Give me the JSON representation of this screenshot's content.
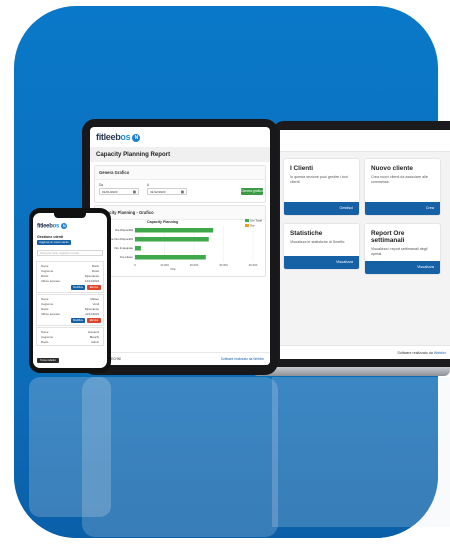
{
  "brand": {
    "name_a": "fitleeb",
    "name_b": "os",
    "badge": "N"
  },
  "laptop": {
    "cards": [
      {
        "title": "I Clienti",
        "text": "In questa sezione puoi gestire i tuoi clienti.",
        "button": "Gestisci"
      },
      {
        "title": "Nuovo cliente",
        "text": "Crea nuovi clienti da associare alle commesse.",
        "button": "Crea"
      },
      {
        "title": "Statistiche",
        "text": "Visualizza le statistiche di Smelfo.",
        "button": "Visualizza"
      },
      {
        "title": "Report Ore settimanali",
        "text": "Visualizza i report settimanali degli operai.",
        "button": "Visualizza"
      }
    ],
    "footer": {
      "text": "Software realizzato da",
      "brand": "Webfox"
    }
  },
  "tablet": {
    "page_title": "Capacity Planning Report",
    "filter": {
      "header": "Genera Grafico",
      "from_label": "Da",
      "to_label": "A",
      "from_value": "01/01/2020",
      "to_value": "31/12/2020",
      "button": "Genera grafico"
    },
    "chart_section_header": "Capacity Planning - Grafico",
    "footer_left": "© 2024 - TECHNI",
    "footer_right": "Software realizzato da Webfox"
  },
  "chart_data": {
    "type": "bar",
    "orientation": "horizontal",
    "title": "Capacity Planning",
    "categories": [
      "Ore Disponibili",
      "Ore Non Disponibili",
      "Ore Impegnate",
      "Ore Libere"
    ],
    "series": [
      {
        "name": "Ore Totali",
        "color": "#3ea84a",
        "values": [
          53000,
          50000,
          4000,
          48000
        ]
      },
      {
        "name": "Ore",
        "color": "#f0a020",
        "values": [
          0,
          0,
          0,
          0
        ]
      }
    ],
    "x_ticks": [
      "0",
      "10.000",
      "20.000",
      "30.000",
      "40.000"
    ],
    "xlim": [
      0,
      80000
    ],
    "xlabel": "Ore"
  },
  "phone": {
    "section_title": "Gestione utenti",
    "add_button": "Aggiungi un nuovo utente",
    "search_placeholder": "Cerca per nome, cognome o email...",
    "records": [
      {
        "rows": [
          [
            "Nome",
            "Mario"
          ],
          [
            "Cognome",
            "Rossi"
          ],
          [
            "Ruolo",
            "Dipendente"
          ],
          [
            "Ultimo accesso",
            "12/12/2023"
          ]
        ],
        "edit": "Modifica",
        "delete": "Elimina"
      },
      {
        "rows": [
          [
            "Nome",
            "Matteo"
          ],
          [
            "Cognome",
            "Verdi"
          ],
          [
            "Ruolo",
            "Dipendente"
          ],
          [
            "Ultimo accesso",
            "11/12/2023"
          ]
        ],
        "edit": "Modifica",
        "delete": "Elimina"
      },
      {
        "rows": [
          [
            "Nome",
            "Giovanni"
          ],
          [
            "Cognome",
            "Bianchi"
          ],
          [
            "Ruolo",
            "Admin"
          ]
        ]
      }
    ],
    "back_button": "Torna indietro"
  },
  "colors": {
    "background": "#0b72c2",
    "primary": "#1660a6",
    "success": "#3c9a46",
    "danger": "#e0442f"
  }
}
